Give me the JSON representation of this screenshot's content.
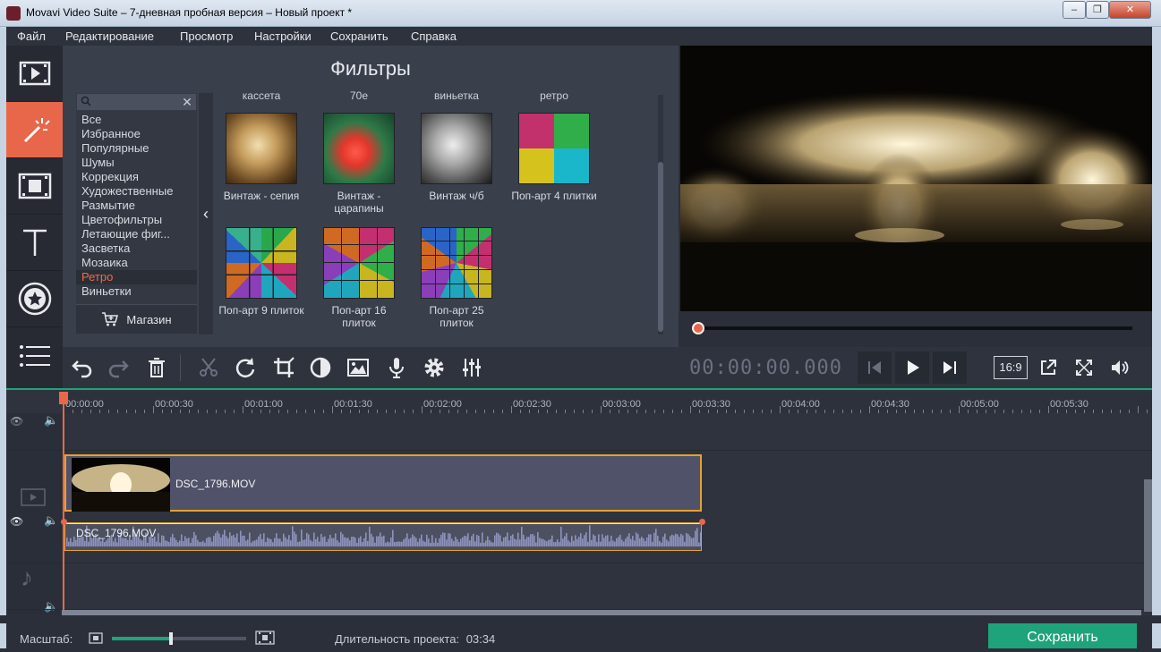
{
  "window": {
    "title": "Movavi Video Suite – 7-дневная пробная версия – Новый проект *",
    "minimize": "‒",
    "maximize": "❐",
    "close": "✕"
  },
  "menu": [
    "Файл",
    "Редактирование",
    "Просмотр",
    "Настройки",
    "Сохранить",
    "Справка"
  ],
  "left_tools": [
    {
      "name": "import-media",
      "icon": "film-play-icon"
    },
    {
      "name": "filters",
      "icon": "magic-wand-icon",
      "active": true
    },
    {
      "name": "transitions",
      "icon": "transition-icon"
    },
    {
      "name": "titles",
      "icon": "text-icon"
    },
    {
      "name": "stickers",
      "icon": "star-badge-icon"
    },
    {
      "name": "more-tools",
      "icon": "list-icon"
    }
  ],
  "filters": {
    "title": "Фильтры",
    "search_placeholder": "",
    "categories": [
      "Все",
      "Избранное",
      "Популярные",
      "Шумы",
      "Коррекция",
      "Художественные",
      "Размытие",
      "Цветофильтры",
      "Летающие фиг...",
      "Засветка",
      "Мозаика",
      "Ретро",
      "Виньетки"
    ],
    "selected_category": "Ретро",
    "store_label": "Магазин",
    "top_captions": [
      "кассета",
      "70е",
      "виньетка",
      "ретро"
    ],
    "tiles": [
      {
        "caption": "Винтаж - сепия"
      },
      {
        "caption": "Винтаж - царапины"
      },
      {
        "caption": "Винтаж ч/б"
      },
      {
        "caption": "Поп-арт 4 плитки"
      },
      {
        "caption": "Поп-арт 9 плиток"
      },
      {
        "caption": "Поп-арт 16 плиток"
      },
      {
        "caption": "Поп-арт 25 плиток"
      }
    ]
  },
  "player": {
    "timecode": "00:00:00.000",
    "aspect": "16:9"
  },
  "timeline": {
    "ticks": [
      "00:00:00",
      "00:00:30",
      "00:01:00",
      "00:01:30",
      "00:02:00",
      "00:02:30",
      "00:03:00",
      "00:03:30",
      "00:04:00",
      "00:04:30",
      "00:05:00",
      "00:05:30"
    ],
    "video_clip": "DSC_1796.MOV",
    "audio_clip": "DSC_1796.MOV"
  },
  "status": {
    "zoom_label": "Масштаб:",
    "zoom_level": 0.44,
    "duration_label": "Длительность проекта:",
    "duration_value": "03:34",
    "save_label": "Сохранить"
  },
  "colors": {
    "accent": "#e8674b",
    "save": "#1fa37a",
    "clip_border": "#e6a12e"
  }
}
